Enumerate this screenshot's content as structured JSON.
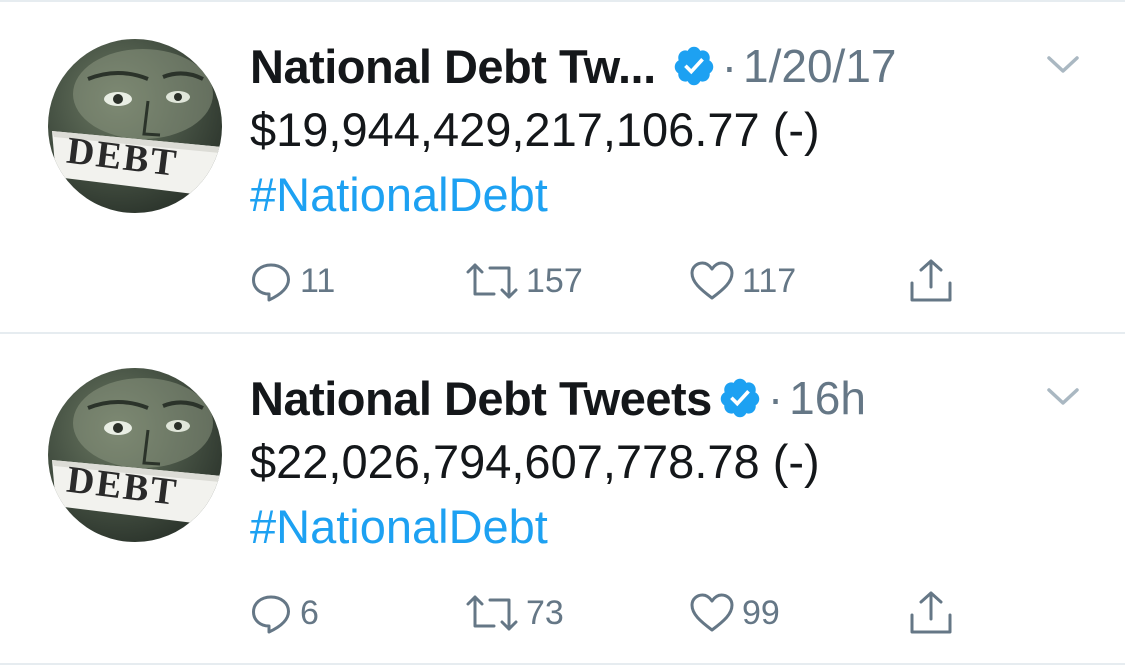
{
  "tweets": [
    {
      "author_name": "National Debt Tw...",
      "separator": "·",
      "timestamp": "1/20/17",
      "amount": "$19,944,429,217,106.77 (-)",
      "hashtag": "#NationalDebt",
      "avatar_text": "DEBT",
      "replies": "11",
      "retweets": "157",
      "likes": "117"
    },
    {
      "author_name": "National Debt Tweets",
      "separator": "·",
      "timestamp": "16h",
      "amount": "$22,026,794,607,778.78 (-)",
      "hashtag": "#NationalDebt",
      "avatar_text": "DEBT",
      "replies": "6",
      "retweets": "73",
      "likes": "99"
    }
  ],
  "icons": {
    "verified": "verified-badge-icon",
    "reply": "speech-bubble-icon",
    "retweet": "retweet-arrows-icon",
    "like": "heart-icon",
    "share": "share-upload-icon",
    "menu": "chevron-down-icon"
  },
  "colors": {
    "text_primary": "#14171a",
    "text_secondary": "#657786",
    "link_blue": "#1da1f2",
    "verified_blue": "#1da1f2",
    "divider": "#e6ecf0"
  }
}
